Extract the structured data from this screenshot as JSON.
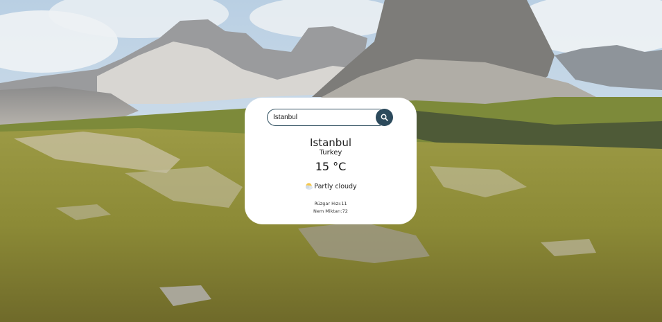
{
  "background": {
    "sky_color": "#c9d8e6",
    "mountain_color": "#8a8d8f",
    "meadow_color": "#8f8f38"
  },
  "search": {
    "value": "İstanbul",
    "button_icon": "search-icon",
    "button_color": "#2c4a5c"
  },
  "weather": {
    "city": "Istanbul",
    "country": "Turkey",
    "temperature": "15 °C",
    "condition_icon": "partly-cloudy-icon",
    "condition": "Partly cloudy",
    "wind": "Rüzgar Hızı:11",
    "humidity": "Nem Miktarı:72"
  }
}
